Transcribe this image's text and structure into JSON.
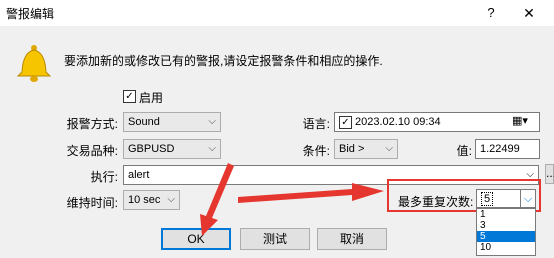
{
  "window": {
    "title": "警报编辑",
    "help_label": "?",
    "close_label": "✕"
  },
  "intro_text": "要添加新的或修改已有的警报,请设定报警条件和相应的操作.",
  "enabled": {
    "label": "启用",
    "checked": true
  },
  "alert_method": {
    "label": "报警方式:",
    "value": "Sound"
  },
  "language": {
    "label": "语言:",
    "value": "2023.02.10 09:34",
    "checked": true
  },
  "symbol": {
    "label": "交易品种:",
    "value": "GBPUSD"
  },
  "condition": {
    "label": "条件:",
    "value": "Bid >"
  },
  "value": {
    "label": "值:",
    "value": "1.22499"
  },
  "action": {
    "label": "执行:",
    "value": "alert",
    "browse_label": "..."
  },
  "timeout": {
    "label": "维持时间:",
    "value": "10 sec"
  },
  "max_repeats": {
    "label": "最多重复次数:",
    "value": "5",
    "options": [
      "1",
      "3",
      "5",
      "10"
    ],
    "selected": "5"
  },
  "buttons": {
    "ok": "OK",
    "test": "测试",
    "cancel": "取消"
  },
  "colors": {
    "highlight": "#e5362f",
    "selection": "#0078d7",
    "arrow": "#e5362f"
  }
}
